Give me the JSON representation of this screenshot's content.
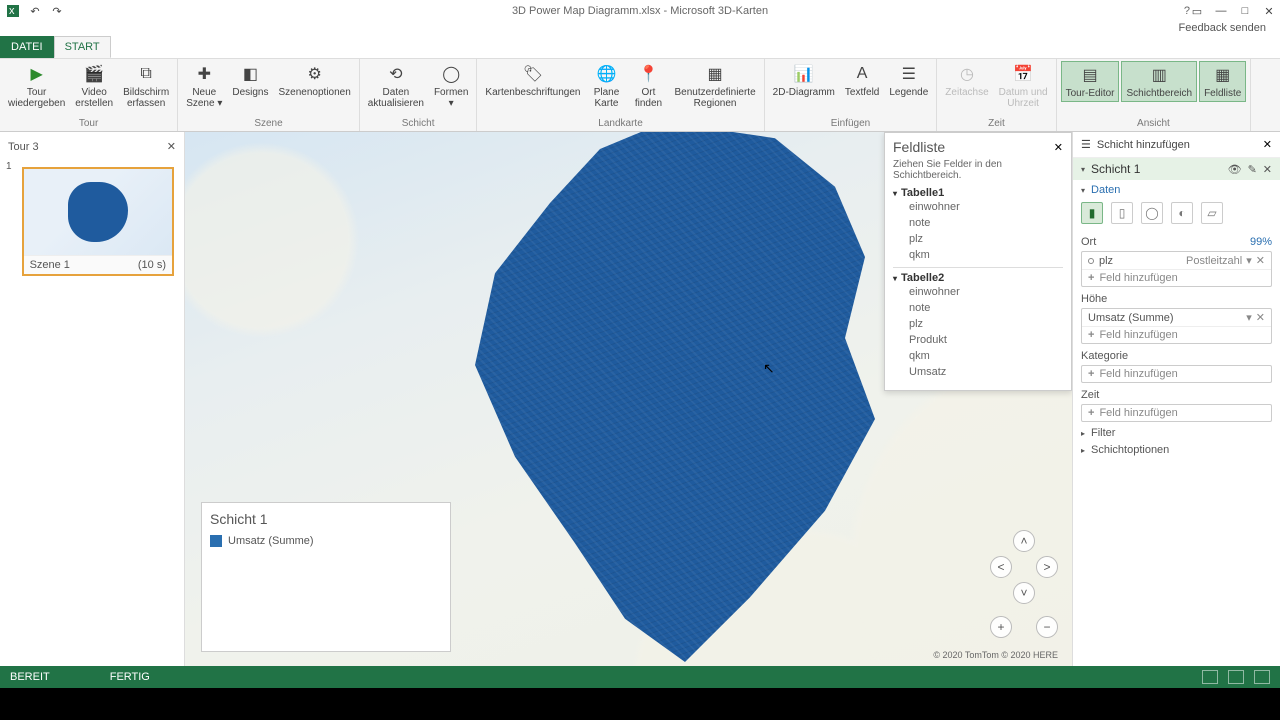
{
  "title": "3D Power Map Diagramm.xlsx - Microsoft 3D-Karten",
  "feedback": "Feedback senden",
  "tabs": {
    "file": "DATEI",
    "start": "START"
  },
  "ribbon": {
    "tour": {
      "group": "Tour",
      "play": "Tour\nwiedergeben",
      "video": "Video\nerstellen",
      "capture": "Bildschirm\nerfassen"
    },
    "scene": {
      "group": "Szene",
      "new": "Neue\nSzene ▾",
      "designs": "Designs",
      "options": "Szenenoptionen"
    },
    "layer": {
      "group": "Schicht",
      "refresh": "Daten\naktualisieren",
      "shapes": "Formen\n▾"
    },
    "map": {
      "group": "Landkarte",
      "labels": "Kartenbeschriftungen",
      "flat": "Plane\nKarte",
      "find": "Ort\nfinden",
      "custom": "Benutzerdefinierte\nRegionen"
    },
    "insert": {
      "group": "Einfügen",
      "chart2d": "2D-Diagramm",
      "textbox": "Textfeld",
      "legend": "Legende"
    },
    "time": {
      "group": "Zeit",
      "timeline": "Zeitachse",
      "datetime": "Datum und\nUhrzeit"
    },
    "view": {
      "group": "Ansicht",
      "editor": "Tour-Editor",
      "pane": "Schichtbereich",
      "fieldlist": "Feldliste"
    }
  },
  "tour": {
    "name": "Tour 3",
    "scene_num": "1",
    "scene_name": "Szene 1",
    "scene_dur": "(10 s)"
  },
  "legend": {
    "title": "Schicht 1",
    "item": "Umsatz (Summe)"
  },
  "fieldlist": {
    "title": "Feldliste",
    "hint": "Ziehen Sie Felder in den Schichtbereich.",
    "t1": {
      "name": "Tabelle1",
      "fields": [
        "einwohner",
        "note",
        "plz",
        "qkm"
      ]
    },
    "t2": {
      "name": "Tabelle2",
      "fields": [
        "einwohner",
        "note",
        "plz",
        "Produkt",
        "qkm",
        "Umsatz"
      ]
    }
  },
  "rpanel": {
    "add_layer": "Schicht hinzufügen",
    "layer_name": "Schicht 1",
    "data": "Daten",
    "ort": {
      "label": "Ort",
      "pct": "99%",
      "field": "plz",
      "type": "Postleitzahl"
    },
    "add_field": "Feld hinzufügen",
    "height": {
      "label": "Höhe",
      "field": "Umsatz (Summe)"
    },
    "category": "Kategorie",
    "time": "Zeit",
    "filter": "Filter",
    "options": "Schichtoptionen"
  },
  "credit": "© 2020 TomTom © 2020 HERE",
  "status": {
    "ready": "BEREIT",
    "done": "FERTIG"
  }
}
